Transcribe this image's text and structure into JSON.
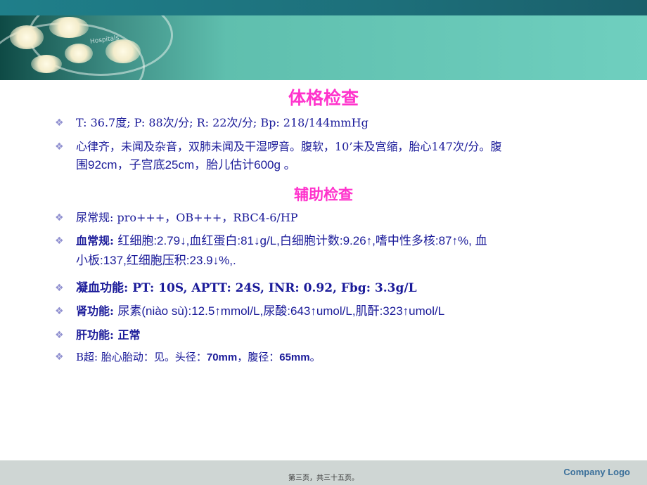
{
  "headings": {
    "physical_exam": "体格检查",
    "auxiliary_exam": "辅助检查"
  },
  "physical": {
    "vitals": "T: 36.7度; P: 88次/分; R: 22次/分; Bp: 218/144mmHg",
    "exam_part1": "心律齐，未闻及杂音，双肺未闻及干湿啰音。腹软，10’未及宫缩，胎心147次/分。腹",
    "exam_part2": "围92cm，子宫底25cm，胎儿估计600g 。"
  },
  "aux": {
    "urine": "尿常规: pro+++，OB+++，RBC4-6/HP",
    "blood_label": "血常规:",
    "blood_part1": "红细胞:2.79↓,血红蛋白:81↓g/L,白细胞计数:9.26↑,嗜中性多核:87↑%, 血",
    "blood_part2": "小板:137,红细胞压积:23.9↓%,.",
    "coag": "凝血功能: PT: 10S, APTT: 24S, INR: 0.92, Fbg: 3.3g/L",
    "renal_label": "肾功能:",
    "renal_value": "尿素(niào sù):12.5↑mmol/L,尿酸:643↑umol/L,肌酐:323↑umol/L",
    "liver": "肝功能: 正常",
    "ultrasound_label": "B超: 胎心胎动：见。头径：",
    "ultrasound_head": "70mm",
    "ultrasound_mid": "，腹径：",
    "ultrasound_abd": "65mm",
    "ultrasound_end": "。"
  },
  "banner_label": "Hospitals",
  "footer": {
    "page": "第三页，共三十五页。",
    "logo": "Company Logo"
  },
  "colors": {
    "heading": "#ff33cc",
    "body_text": "#1a1a99",
    "bullet": "#9090d0"
  },
  "icons": {
    "bullet": "diamond-bullet-icon"
  }
}
